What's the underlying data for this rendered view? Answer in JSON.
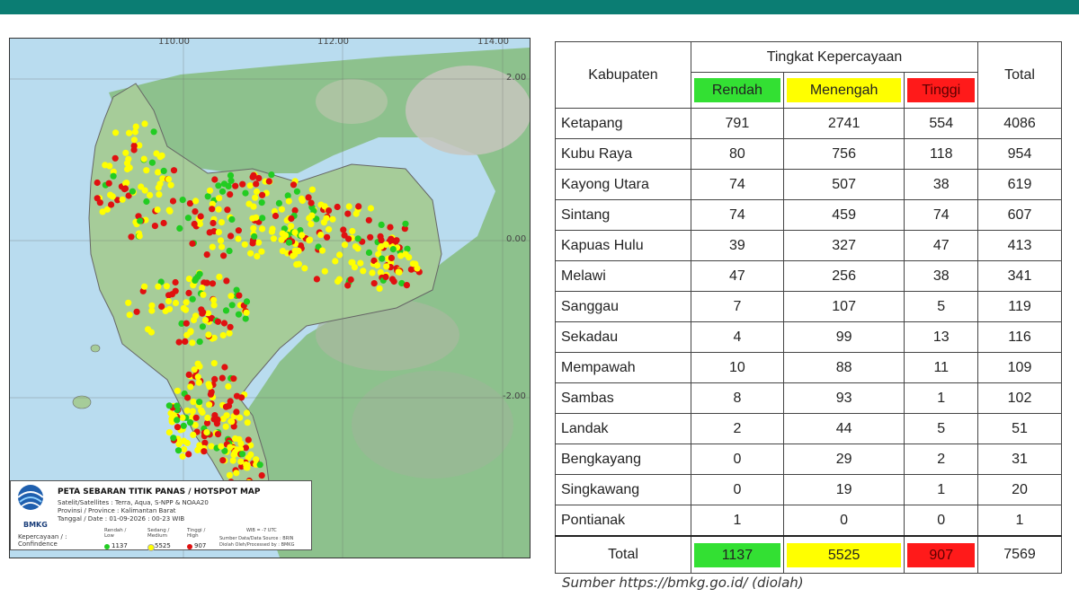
{
  "map": {
    "lon_ticks": [
      "110.00",
      "112.00",
      "114.00"
    ],
    "lat_ticks": [
      "2.00",
      "0.00",
      "-2.00"
    ],
    "legend": {
      "org": "BMKG",
      "title": "PETA SEBARAN TITIK PANAS / HOTSPOT MAP",
      "satellites": "Satelit/Satellites : Terra, Aqua, S-NPP & NOAA20",
      "province": "Provinsi / Province : Kalimantan Barat",
      "date": "Tanggal / Date : 01-09-2026 : 00-23 WIB",
      "confidence_label": "Kepercayaan / :",
      "confidence_label2": "Confindence",
      "categories": [
        {
          "line1": "Rendah /",
          "line2": "Low",
          "count": "1137",
          "color": "#22cc22"
        },
        {
          "line1": "Sedang /",
          "line2": "Medium",
          "count": "5525",
          "color": "#ffff00"
        },
        {
          "line1": "Tinggi /",
          "line2": "High",
          "count": "907",
          "color": "#e01010"
        }
      ],
      "tz": "WIB = -7 UTC",
      "source_line1": "Sumber Data/Data Source : BRIN",
      "source_line2": "Diolah Oleh/Processed by : BMKG"
    },
    "hotspot_counts": {
      "low": 1137,
      "medium": 5525,
      "high": 907
    }
  },
  "table": {
    "header": {
      "kabupaten": "Kabupaten",
      "group": "Tingkat Kepercayaan",
      "low": "Rendah",
      "medium": "Menengah",
      "high": "Tinggi",
      "total": "Total"
    },
    "rows": [
      {
        "name": "Ketapang",
        "low": "791",
        "medium": "2741",
        "high": "554",
        "total": "4086"
      },
      {
        "name": "Kubu Raya",
        "low": "80",
        "medium": "756",
        "high": "118",
        "total": "954"
      },
      {
        "name": "Kayong Utara",
        "low": "74",
        "medium": "507",
        "high": "38",
        "total": "619"
      },
      {
        "name": "Sintang",
        "low": "74",
        "medium": "459",
        "high": "74",
        "total": "607"
      },
      {
        "name": "Kapuas Hulu",
        "low": "39",
        "medium": "327",
        "high": "47",
        "total": "413"
      },
      {
        "name": "Melawi",
        "low": "47",
        "medium": "256",
        "high": "38",
        "total": "341"
      },
      {
        "name": "Sanggau",
        "low": "7",
        "medium": "107",
        "high": "5",
        "total": "119"
      },
      {
        "name": "Sekadau",
        "low": "4",
        "medium": "99",
        "high": "13",
        "total": "116"
      },
      {
        "name": "Mempawah",
        "low": "10",
        "medium": "88",
        "high": "11",
        "total": "109"
      },
      {
        "name": "Sambas",
        "low": "8",
        "medium": "93",
        "high": "1",
        "total": "102"
      },
      {
        "name": "Landak",
        "low": "2",
        "medium": "44",
        "high": "5",
        "total": "51"
      },
      {
        "name": "Bengkayang",
        "low": "0",
        "medium": "29",
        "high": "2",
        "total": "31"
      },
      {
        "name": "Singkawang",
        "low": "0",
        "medium": "19",
        "high": "1",
        "total": "20"
      },
      {
        "name": "Pontianak",
        "low": "1",
        "medium": "0",
        "high": "0",
        "total": "1"
      }
    ],
    "totals": {
      "label": "Total",
      "low": "1137",
      "medium": "5525",
      "high": "907",
      "total": "7569"
    }
  },
  "source": "Sumber https://bmkg.go.id/ (diolah)",
  "colors": {
    "topbar": "#0b7d73",
    "low": "#33e033",
    "medium": "#ffff00",
    "high": "#ff1a1a"
  }
}
